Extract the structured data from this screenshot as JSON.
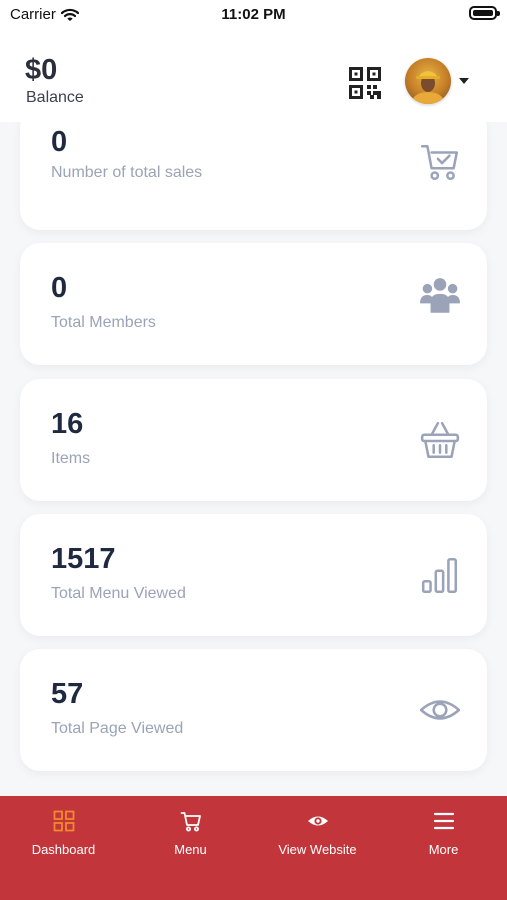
{
  "status_bar": {
    "carrier": "Carrier",
    "time": "11:02 PM"
  },
  "header": {
    "balance": "$0",
    "balance_label": "Balance"
  },
  "stats": [
    {
      "value": "0",
      "label": "Number of total sales",
      "icon": "cart-check-icon"
    },
    {
      "value": "0",
      "label": "Total Members",
      "icon": "users-icon"
    },
    {
      "value": "16",
      "label": "Items",
      "icon": "basket-icon"
    },
    {
      "value": "1517",
      "label": "Total Menu Viewed",
      "icon": "bar-chart-icon"
    },
    {
      "value": "57",
      "label": "Total Page Viewed",
      "icon": "eye-icon"
    }
  ],
  "tabs": [
    {
      "label": "Dashboard",
      "icon": "grid-icon",
      "active": true
    },
    {
      "label": "Menu",
      "icon": "cart-icon"
    },
    {
      "label": "View Website",
      "icon": "eye-icon"
    },
    {
      "label": "More",
      "icon": "menu-icon"
    }
  ],
  "colors": {
    "tab_bar": "#c2353b",
    "active_tab_icon": "#f0892f",
    "stat_icon": "#9aa3b7",
    "value_text": "#1f2940"
  }
}
